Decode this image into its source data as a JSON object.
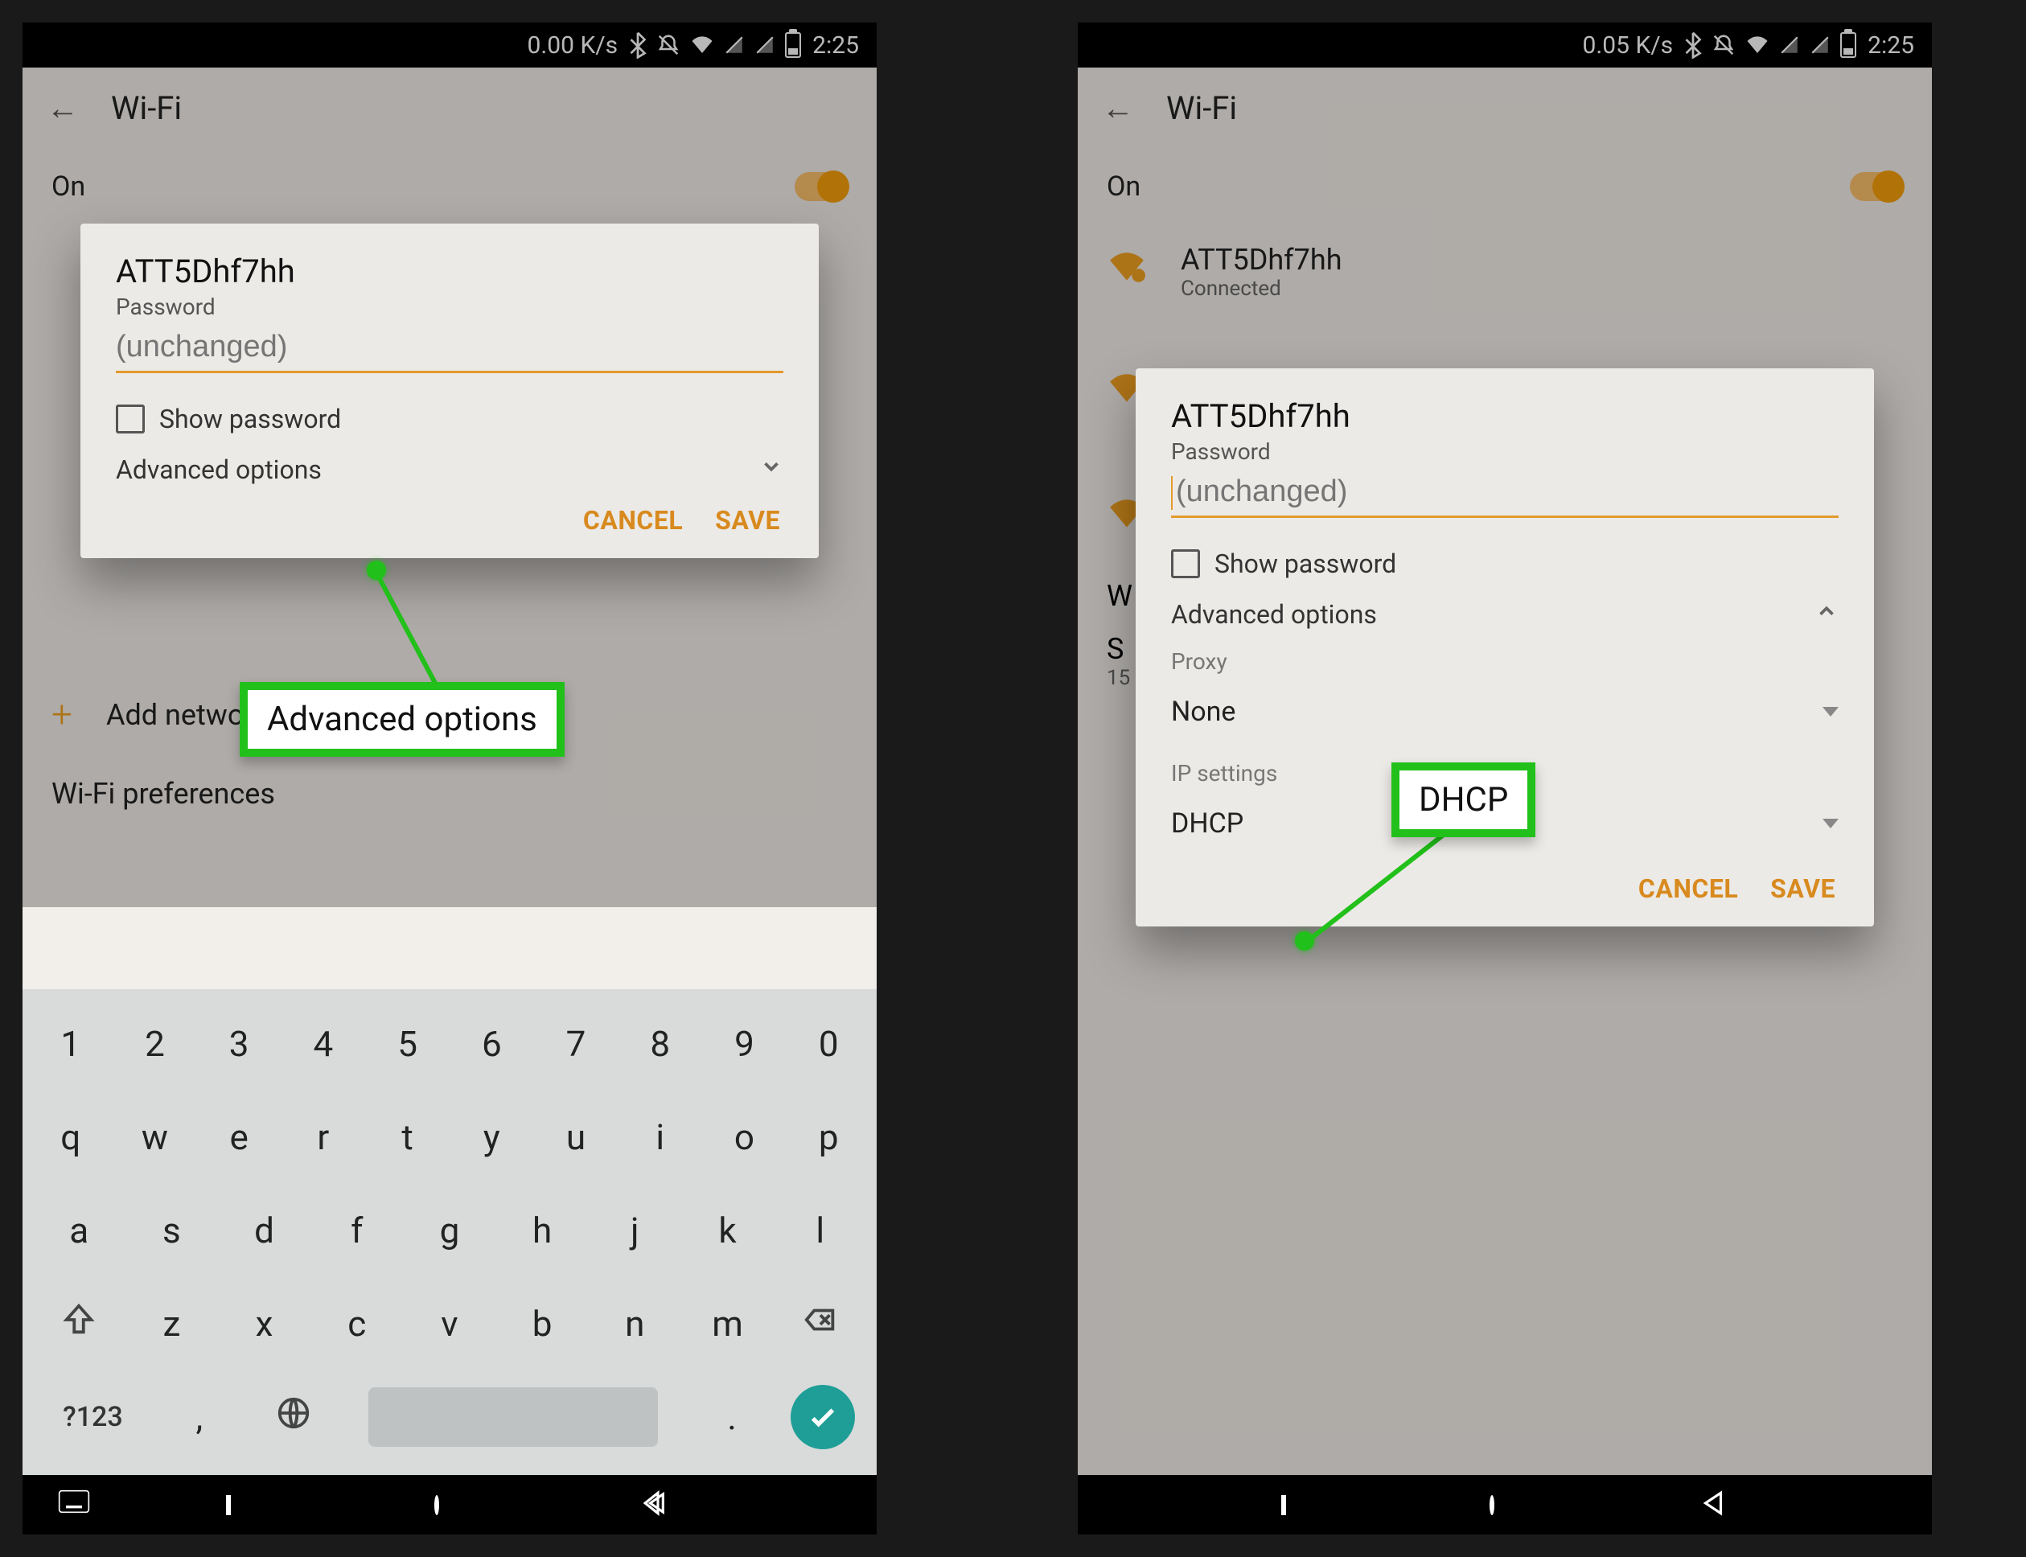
{
  "left": {
    "status": {
      "rate": "0.00 K/s",
      "time": "2:25"
    },
    "appbar_title": "Wi-Fi",
    "wifi_on_label": "On",
    "add_network": "Add network",
    "wifi_preferences": "Wi-Fi preferences",
    "dialog": {
      "ssid": "ATT5Dhf7hh",
      "password_label": "Password",
      "password_placeholder": "(unchanged)",
      "show_password": "Show password",
      "advanced_options": "Advanced options",
      "cancel": "CANCEL",
      "save": "SAVE"
    },
    "callout_text": "Advanced options",
    "keyboard": {
      "row1": [
        "1",
        "2",
        "3",
        "4",
        "5",
        "6",
        "7",
        "8",
        "9",
        "0"
      ],
      "row2": [
        "q",
        "w",
        "e",
        "r",
        "t",
        "y",
        "u",
        "i",
        "o",
        "p"
      ],
      "row3": [
        "a",
        "s",
        "d",
        "f",
        "g",
        "h",
        "j",
        "k",
        "l"
      ],
      "row4_letters": [
        "z",
        "x",
        "c",
        "v",
        "b",
        "n",
        "m"
      ],
      "sym": "?123",
      "comma": ",",
      "period": "."
    }
  },
  "right": {
    "status": {
      "rate": "0.05 K/s",
      "time": "2:25"
    },
    "appbar_title": "Wi-Fi",
    "wifi_on_label": "On",
    "connected_net": {
      "ssid": "ATT5Dhf7hh",
      "status": "Connected"
    },
    "bg_pref_initial": "W",
    "bg_s_line1": "S",
    "bg_s_line2": "15",
    "dialog": {
      "ssid": "ATT5Dhf7hh",
      "password_label": "Password",
      "password_placeholder": "(unchanged)",
      "show_password": "Show password",
      "advanced_options": "Advanced options",
      "proxy_label": "Proxy",
      "proxy_value": "None",
      "ip_label": "IP settings",
      "ip_value": "DHCP",
      "cancel": "CANCEL",
      "save": "SAVE"
    },
    "callout_text": "DHCP"
  }
}
